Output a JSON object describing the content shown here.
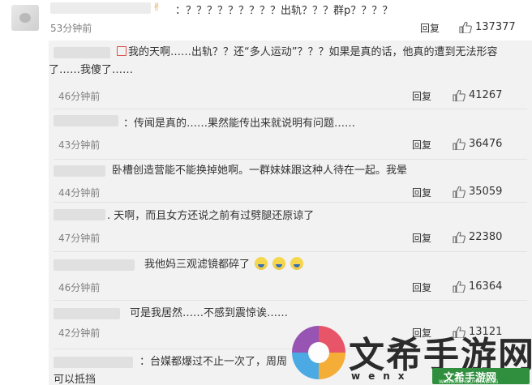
{
  "top_comment": {
    "text": "：？？？？？？？？？出轨？？？群p？？？？",
    "time": "53分钟前",
    "reply": "回复",
    "likes": "137377"
  },
  "comments": [
    {
      "text": "我的天啊……出轨？？还“多人运动”？？？如果是真的话，他真的遭到无法形容了……我傻了……",
      "time": "46分钟前",
      "reply": "回复",
      "likes": "41267"
    },
    {
      "text": "：传闻是真的……果然能传出来就说明有问题……",
      "time": "43分钟前",
      "reply": "回复",
      "likes": "36476"
    },
    {
      "text": "卧槽创造营能不能换掉她啊。一群妹妹跟这种人待在一起。我晕",
      "time": "44分钟前",
      "reply": "回复",
      "likes": "35059"
    },
    {
      "text": ". 天啊，而且女方还说之前有过劈腿还原谅了",
      "time": "47分钟前",
      "reply": "回复",
      "likes": "22380"
    },
    {
      "text": "我他妈三观滤镜都碎了",
      "time": "46分钟前",
      "reply": "回复",
      "likes": "16364"
    },
    {
      "text": "可是我居然……不感到震惊诶……",
      "time": "42分钟前",
      "reply": "回复",
      "likes": "13121"
    },
    {
      "text": "：台媒都爆过不止一次了，周周",
      "time": "",
      "reply": "",
      "likes": ""
    }
  ],
  "truncated_tail": "可以抵挡",
  "watermark": {
    "title": "文希手游网",
    "wenx": "wenx",
    "site_cn": "文希手游网",
    "site_domain": "WANGXISHOUYOUWANG"
  },
  "colors": {
    "panel_bg": "#f2f2f2",
    "meta_gray": "#808080",
    "text": "#333333"
  }
}
